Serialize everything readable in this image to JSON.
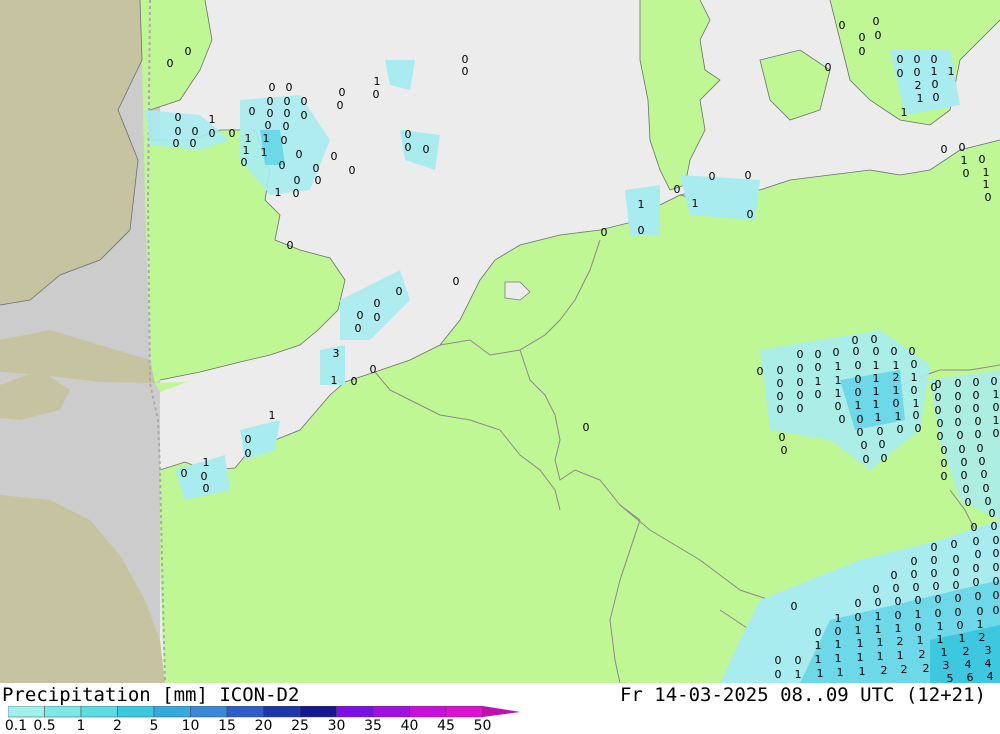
{
  "footer": {
    "title": "Precipitation [mm] ICON-D2",
    "datetime": "Fr 14-03-2025 08..09 UTC (12+21)"
  },
  "legend": {
    "labels": [
      "0.1",
      "0.5",
      "1",
      "2",
      "5",
      "10",
      "15",
      "20",
      "25",
      "30",
      "35",
      "40",
      "45",
      "50"
    ],
    "colors": [
      "#a0f0f0",
      "#7ee8e8",
      "#5cdce0",
      "#3ec8e0",
      "#36aade",
      "#3a88d8",
      "#2e5cc8",
      "#1e36a8",
      "#141890",
      "#7a10e8",
      "#a010e0",
      "#c810dc",
      "#e010d0",
      "#c010b0"
    ]
  },
  "map_colors": {
    "sea": "#ececec",
    "land_model": "#bff794",
    "land_outside": "#c6c4a0",
    "sea_outside": "#cccccc",
    "light_precip": "#a8ecf0",
    "medium_precip": "#6cd8e8"
  }
}
